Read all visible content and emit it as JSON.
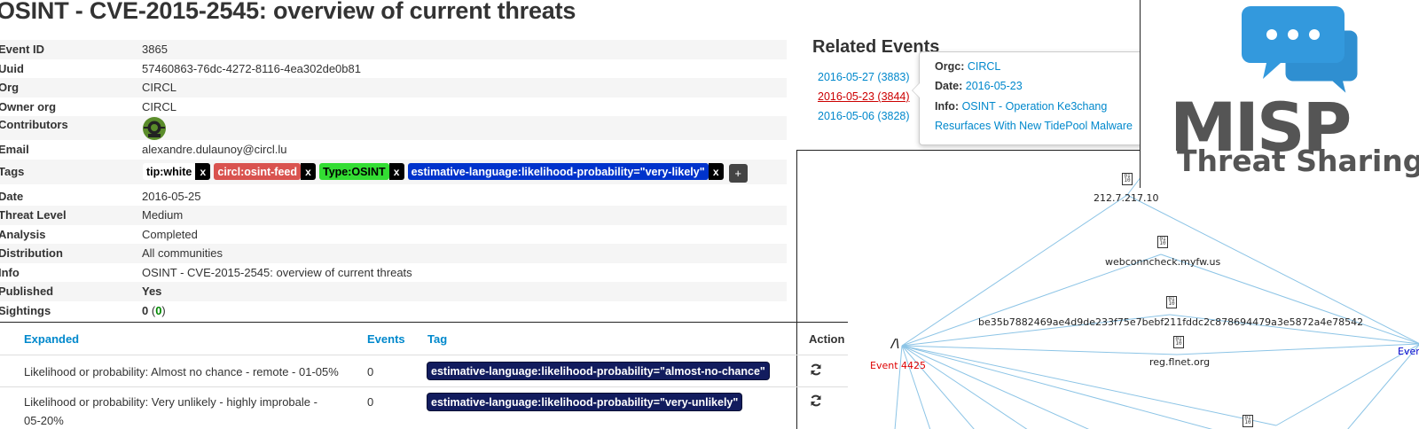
{
  "page": {
    "title": "OSINT - CVE-2015-2545: overview of current threats"
  },
  "details": {
    "event_id": {
      "key": "Event ID",
      "value": "3865"
    },
    "uuid": {
      "key": "Uuid",
      "value": "57460863-76dc-4272-8116-4ea302de0b81"
    },
    "org": {
      "key": "Org",
      "value": "CIRCL"
    },
    "owner_org": {
      "key": "Owner org",
      "value": "CIRCL"
    },
    "contributors": {
      "key": "Contributors"
    },
    "email": {
      "key": "Email",
      "value": "alexandre.dulaunoy@circl.lu"
    },
    "tags_label": "Tags",
    "tags": [
      {
        "label": "tip:white",
        "color": "#ffffff",
        "text_color": "#000000"
      },
      {
        "label": "circl:osint-feed",
        "color": "#d9534f",
        "text_color": "#ffffff"
      },
      {
        "label": "Type:OSINT",
        "color": "#33dd33",
        "text_color": "#000000"
      },
      {
        "label": "estimative-language:likelihood-probability=\"very-likely\"",
        "color": "#0033cc",
        "text_color": "#ffffff"
      }
    ],
    "tag_remove": "x",
    "tag_add": "+",
    "date": {
      "key": "Date",
      "value": "2016-05-25"
    },
    "threat_level": {
      "key": "Threat Level",
      "value": "Medium"
    },
    "analysis": {
      "key": "Analysis",
      "value": "Completed"
    },
    "distribution": {
      "key": "Distribution",
      "value": "All communities"
    },
    "info": {
      "key": "Info",
      "value": "OSINT - CVE-2015-2545: overview of current threats"
    },
    "published": {
      "key": "Published",
      "value": "Yes"
    },
    "sightings": {
      "key": "Sightings",
      "value": "0",
      "paren_value": "0"
    }
  },
  "related": {
    "title": "Related Events",
    "items": [
      {
        "label": "2016-05-27 (3883)"
      },
      {
        "label": "2016-05-23 (3844)"
      },
      {
        "label": "2016-05-06 (3828)"
      }
    ],
    "popover": {
      "orgc_key": "Orgc",
      "orgc_value": "CIRCL",
      "date_key": "Date",
      "date_value": "2016-05-23",
      "info_key": "Info",
      "info_value": "OSINT - Operation Ke3chang",
      "info_value_2": "Resurfaces With New TidePool Malware"
    }
  },
  "logo": {
    "text": "MISP",
    "subtitle": "Threat Sharing",
    "color": "#3399dd"
  },
  "graph": {
    "nodes": [
      {
        "label": "212.7.217.10"
      },
      {
        "label": "webconncheck.myfw.us"
      },
      {
        "label": "be35b7882469ae4d9de233f75e7bebf211fddc2c878694479a3e5872a4e78542"
      },
      {
        "label": "reg.flnet.org"
      },
      {
        "label": "Event 4425"
      },
      {
        "label": "Ever"
      }
    ],
    "node_glyph": "/\\"
  },
  "tag_table": {
    "headers": {
      "expanded": "Expanded",
      "events": "Events",
      "tag": "Tag",
      "action": "Action"
    },
    "rows": [
      {
        "expanded": "Likelihood or probability: Almost no chance - remote - 01-05%",
        "events": "0",
        "tag": "estimative-language:likelihood-probability=\"almost-no-chance\""
      },
      {
        "expanded_1": "Likelihood or probability: Very unlikely - highly improbale -",
        "expanded_2": "05-20%",
        "events": "0",
        "tag": "estimative-language:likelihood-probability=\"very-unlikely\""
      }
    ]
  }
}
